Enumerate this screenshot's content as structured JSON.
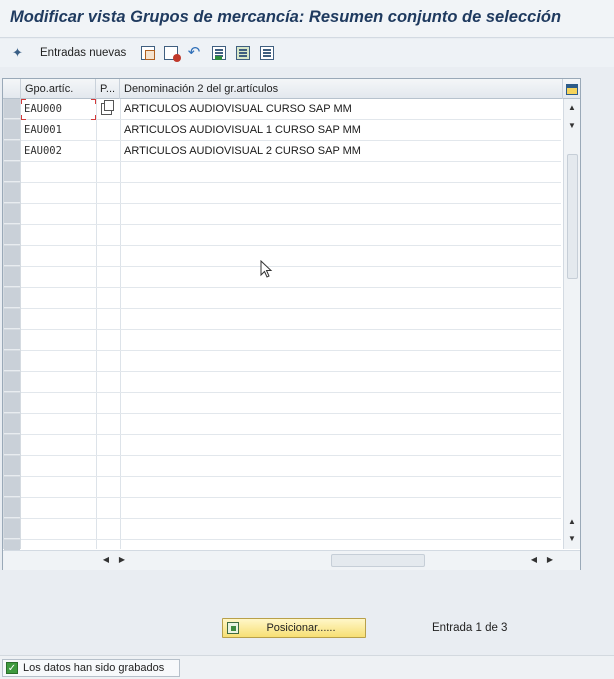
{
  "title": "Modificar vista Grupos de mercancía: Resumen conjunto de selección",
  "toolbar": {
    "new_entries_label": "Entradas nuevas",
    "icons": [
      "glasses-icon",
      "copy-icon",
      "delete-icon",
      "undo-icon",
      "select-block-icon",
      "select-all-icon",
      "deselect-all-icon"
    ]
  },
  "table": {
    "columns": [
      "Gpo.artíc.",
      "P...",
      "Denominación 2 del gr.artículos"
    ],
    "rows": [
      {
        "code": "EAU000",
        "desc": "ARTICULOS AUDIOVISUAL CURSO SAP MM"
      },
      {
        "code": "EAU001",
        "desc": "ARTICULOS AUDIOVISUAL 1 CURSO SAP MM"
      },
      {
        "code": "EAU002",
        "desc": "ARTICULOS AUDIOVISUAL 2 CURSO SAP MM"
      }
    ]
  },
  "footer": {
    "position_button_label": "Posicionar......",
    "entry_info": "Entrada 1 de 3"
  },
  "status": {
    "message": "Los datos han sido grabados",
    "type": "success"
  },
  "colors": {
    "title": "#1f3a5f",
    "button_bg": "#f7df74",
    "status_ok": "#3e9a3e"
  }
}
